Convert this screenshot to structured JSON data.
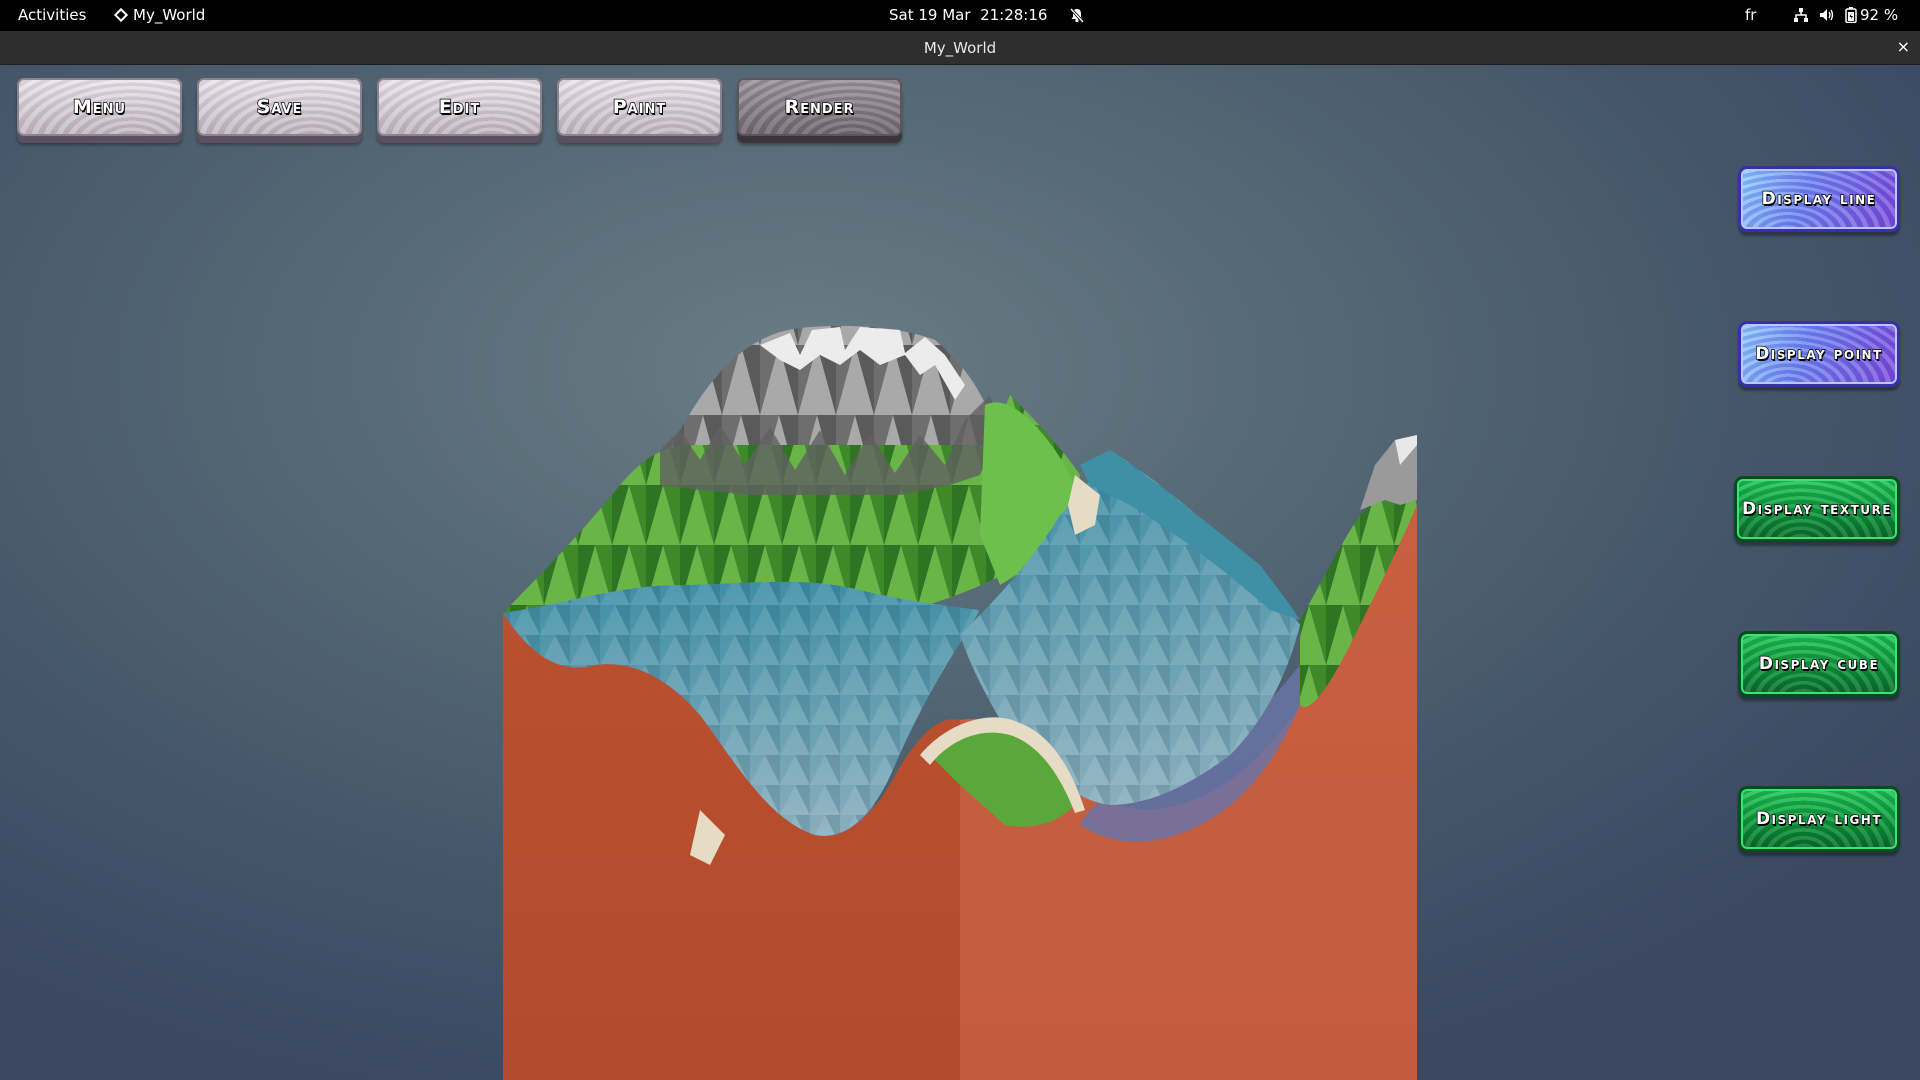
{
  "topbar": {
    "activities": "Activities",
    "app_name": "My_World",
    "date": "Sat 19 Mar",
    "time": "21:28:16",
    "keyboard_layout": "fr",
    "battery": "92 %",
    "icons": [
      "app-diamond-icon",
      "notifications-off-icon",
      "network-icon",
      "volume-icon",
      "battery-icon"
    ]
  },
  "window": {
    "title": "My_World",
    "close_glyph": "×"
  },
  "toolbar": {
    "buttons": [
      {
        "label": "Menu"
      },
      {
        "label": "Save"
      },
      {
        "label": "Edit"
      },
      {
        "label": "Paint"
      },
      {
        "label": "Render"
      }
    ]
  },
  "display_panel": {
    "buttons": [
      {
        "label": "Display line",
        "color": "#6d86f0"
      },
      {
        "label": "Display point",
        "color": "#6d86f0"
      },
      {
        "label": "Display texture",
        "color": "#0c9a3c"
      },
      {
        "label": "Display cube",
        "color": "#0c9a3c"
      },
      {
        "label": "Display light",
        "color": "#0c9a3c"
      }
    ]
  },
  "colors": {
    "soil": "#c0573a",
    "grass": "#5aa83c",
    "water": "#6fa7b8",
    "rock": "#8a8a8a",
    "snow": "#f2f2f2"
  }
}
